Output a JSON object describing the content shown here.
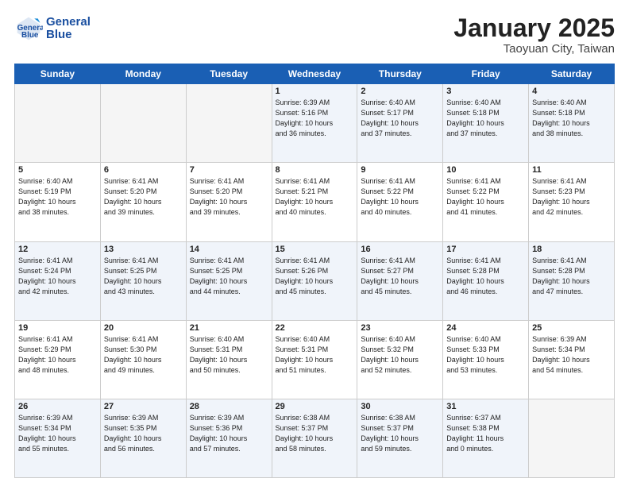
{
  "logo": {
    "line1": "General",
    "line2": "Blue"
  },
  "header": {
    "month": "January 2025",
    "location": "Taoyuan City, Taiwan"
  },
  "weekdays": [
    "Sunday",
    "Monday",
    "Tuesday",
    "Wednesday",
    "Thursday",
    "Friday",
    "Saturday"
  ],
  "rows": [
    [
      {
        "day": "",
        "info": ""
      },
      {
        "day": "",
        "info": ""
      },
      {
        "day": "",
        "info": ""
      },
      {
        "day": "1",
        "info": "Sunrise: 6:39 AM\nSunset: 5:16 PM\nDaylight: 10 hours\nand 36 minutes."
      },
      {
        "day": "2",
        "info": "Sunrise: 6:40 AM\nSunset: 5:17 PM\nDaylight: 10 hours\nand 37 minutes."
      },
      {
        "day": "3",
        "info": "Sunrise: 6:40 AM\nSunset: 5:18 PM\nDaylight: 10 hours\nand 37 minutes."
      },
      {
        "day": "4",
        "info": "Sunrise: 6:40 AM\nSunset: 5:18 PM\nDaylight: 10 hours\nand 38 minutes."
      }
    ],
    [
      {
        "day": "5",
        "info": "Sunrise: 6:40 AM\nSunset: 5:19 PM\nDaylight: 10 hours\nand 38 minutes."
      },
      {
        "day": "6",
        "info": "Sunrise: 6:41 AM\nSunset: 5:20 PM\nDaylight: 10 hours\nand 39 minutes."
      },
      {
        "day": "7",
        "info": "Sunrise: 6:41 AM\nSunset: 5:20 PM\nDaylight: 10 hours\nand 39 minutes."
      },
      {
        "day": "8",
        "info": "Sunrise: 6:41 AM\nSunset: 5:21 PM\nDaylight: 10 hours\nand 40 minutes."
      },
      {
        "day": "9",
        "info": "Sunrise: 6:41 AM\nSunset: 5:22 PM\nDaylight: 10 hours\nand 40 minutes."
      },
      {
        "day": "10",
        "info": "Sunrise: 6:41 AM\nSunset: 5:22 PM\nDaylight: 10 hours\nand 41 minutes."
      },
      {
        "day": "11",
        "info": "Sunrise: 6:41 AM\nSunset: 5:23 PM\nDaylight: 10 hours\nand 42 minutes."
      }
    ],
    [
      {
        "day": "12",
        "info": "Sunrise: 6:41 AM\nSunset: 5:24 PM\nDaylight: 10 hours\nand 42 minutes."
      },
      {
        "day": "13",
        "info": "Sunrise: 6:41 AM\nSunset: 5:25 PM\nDaylight: 10 hours\nand 43 minutes."
      },
      {
        "day": "14",
        "info": "Sunrise: 6:41 AM\nSunset: 5:25 PM\nDaylight: 10 hours\nand 44 minutes."
      },
      {
        "day": "15",
        "info": "Sunrise: 6:41 AM\nSunset: 5:26 PM\nDaylight: 10 hours\nand 45 minutes."
      },
      {
        "day": "16",
        "info": "Sunrise: 6:41 AM\nSunset: 5:27 PM\nDaylight: 10 hours\nand 45 minutes."
      },
      {
        "day": "17",
        "info": "Sunrise: 6:41 AM\nSunset: 5:28 PM\nDaylight: 10 hours\nand 46 minutes."
      },
      {
        "day": "18",
        "info": "Sunrise: 6:41 AM\nSunset: 5:28 PM\nDaylight: 10 hours\nand 47 minutes."
      }
    ],
    [
      {
        "day": "19",
        "info": "Sunrise: 6:41 AM\nSunset: 5:29 PM\nDaylight: 10 hours\nand 48 minutes."
      },
      {
        "day": "20",
        "info": "Sunrise: 6:41 AM\nSunset: 5:30 PM\nDaylight: 10 hours\nand 49 minutes."
      },
      {
        "day": "21",
        "info": "Sunrise: 6:40 AM\nSunset: 5:31 PM\nDaylight: 10 hours\nand 50 minutes."
      },
      {
        "day": "22",
        "info": "Sunrise: 6:40 AM\nSunset: 5:31 PM\nDaylight: 10 hours\nand 51 minutes."
      },
      {
        "day": "23",
        "info": "Sunrise: 6:40 AM\nSunset: 5:32 PM\nDaylight: 10 hours\nand 52 minutes."
      },
      {
        "day": "24",
        "info": "Sunrise: 6:40 AM\nSunset: 5:33 PM\nDaylight: 10 hours\nand 53 minutes."
      },
      {
        "day": "25",
        "info": "Sunrise: 6:39 AM\nSunset: 5:34 PM\nDaylight: 10 hours\nand 54 minutes."
      }
    ],
    [
      {
        "day": "26",
        "info": "Sunrise: 6:39 AM\nSunset: 5:34 PM\nDaylight: 10 hours\nand 55 minutes."
      },
      {
        "day": "27",
        "info": "Sunrise: 6:39 AM\nSunset: 5:35 PM\nDaylight: 10 hours\nand 56 minutes."
      },
      {
        "day": "28",
        "info": "Sunrise: 6:39 AM\nSunset: 5:36 PM\nDaylight: 10 hours\nand 57 minutes."
      },
      {
        "day": "29",
        "info": "Sunrise: 6:38 AM\nSunset: 5:37 PM\nDaylight: 10 hours\nand 58 minutes."
      },
      {
        "day": "30",
        "info": "Sunrise: 6:38 AM\nSunset: 5:37 PM\nDaylight: 10 hours\nand 59 minutes."
      },
      {
        "day": "31",
        "info": "Sunrise: 6:37 AM\nSunset: 5:38 PM\nDaylight: 11 hours\nand 0 minutes."
      },
      {
        "day": "",
        "info": ""
      }
    ]
  ],
  "alt_rows": [
    0,
    2,
    4
  ]
}
